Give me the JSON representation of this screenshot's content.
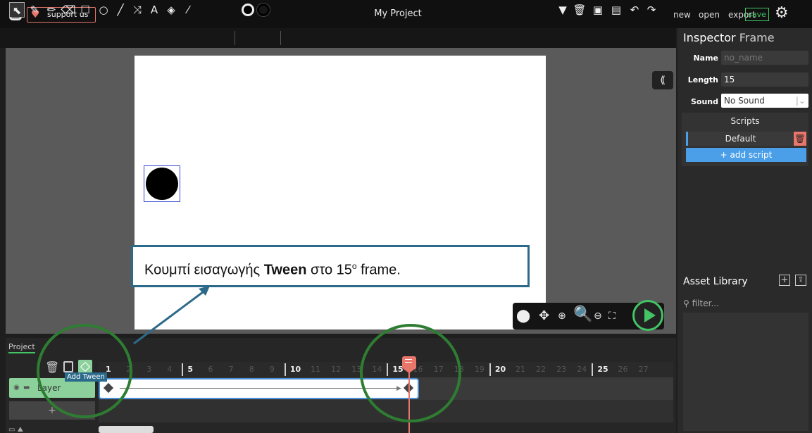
{
  "topbar": {
    "support_label": "support us",
    "project_title": "My Project",
    "menu": {
      "new": "new",
      "open": "open",
      "export": "export",
      "save": "save"
    }
  },
  "toolbar": {
    "tools": [
      "cursor-icon",
      "brush-icon",
      "pencil-icon",
      "eraser-icon",
      "rectangle-icon",
      "ellipse-icon",
      "line-icon",
      "pathcursor-icon",
      "text-icon",
      "fill-bucket-icon",
      "eyedropper-icon"
    ],
    "fill_color": "#000000",
    "stroke_color": "#000000"
  },
  "canvas": {
    "collapse_label": "⟪"
  },
  "callout": {
    "text_before": "Κουμπί εισαγωγής ",
    "text_bold": "Tween",
    "text_after": " στο 15",
    "superscript": "ο",
    "text_end": " frame."
  },
  "timeline": {
    "tab_label": "Project",
    "layer_name": "Layer",
    "add_layer": "+",
    "tooltip": "Add Tween",
    "frame_numbers": [
      "1",
      "2",
      "3",
      "4",
      "5",
      "6",
      "7",
      "8",
      "9",
      "10",
      "11",
      "12",
      "13",
      "14",
      "15",
      "16",
      "17",
      "18",
      "19",
      "20",
      "21",
      "22",
      "23",
      "24",
      "25",
      "26",
      "27"
    ],
    "current_frame": 15
  },
  "inspector": {
    "title": "Inspector",
    "subtitle": "Frame",
    "name_label": "Name",
    "name_placeholder": "no_name",
    "length_label": "Length",
    "length_value": "15",
    "sound_label": "Sound",
    "sound_value": "No Sound",
    "scripts_title": "Scripts",
    "script_default": "Default",
    "add_script": "+ add script"
  },
  "assets": {
    "title": "Asset Library",
    "filter_placeholder": "filter..."
  },
  "colors": {
    "accent_green": "#43c465",
    "playhead_red": "#e8766b",
    "script_blue": "#4a9fe8",
    "callout_border": "#2d6a8a",
    "annotation_circle": "#2e7d32"
  }
}
